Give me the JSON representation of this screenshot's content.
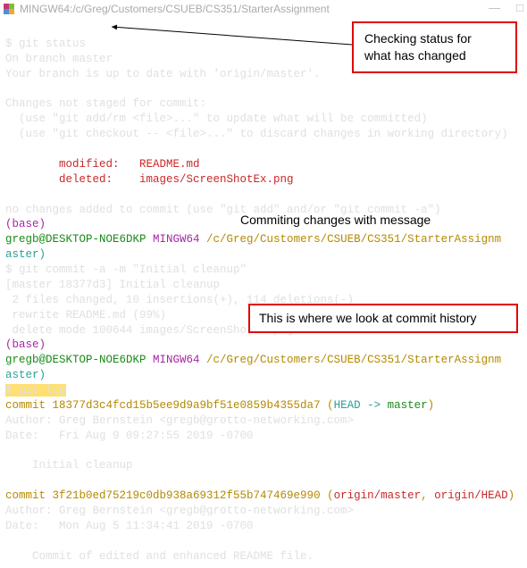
{
  "titlebar": {
    "title": "MINGW64:/c/Greg/Customers/CSUEB/CS351/StarterAssignment",
    "min": "—",
    "max": "□"
  },
  "term": {
    "l1": "$ git status",
    "l2": "On branch master",
    "l3": "Your branch is up to date with 'origin/master'.",
    "l4": "",
    "l5": "Changes not staged for commit:",
    "l6": "  (use \"git add/rm <file>...\" to update what will be committed)",
    "l7": "  (use \"git checkout -- <file>...\" to discard changes in working directory)",
    "l8": "",
    "l9": "        modified:   README.md",
    "l10": "        deleted:    images/ScreenShotEx.png",
    "l11": "",
    "l12": "no changes added to commit (use \"git add\" and/or \"git commit -a\")",
    "base": "(base)",
    "prompt_user": "gregb@DESKTOP-NOE6DKP",
    "prompt_mingw": " MINGW64 ",
    "prompt_path": "/c/Greg/Customers/CSUEB/CS351/StarterAssignm",
    "prompt_branch": "aster)",
    "l15": "$ git commit -a -m \"Initial cleanup\"",
    "l16": "[master 18377d3] Initial cleanup",
    "l17": " 2 files changed, 10 insertions(+), 114 deletions(-)",
    "l18": " rewrite README.md (99%)",
    "l19": " delete mode 100644 images/ScreenShotEx.png",
    "prompt_path2": "/c/Greg/Customers/CSUEB/CS351/StarterAssignm",
    "l22": "$ git log",
    "l23a": "commit ",
    "l23b": "18377d3c4fcd15b5ee9d9a9bf51e0859b4355da7",
    "l23c": " (",
    "l23d": "HEAD -> ",
    "l23e": "master",
    "l23f": ")",
    "l24": "Author: Greg Bernstein <gregb@grotto-networking.com>",
    "l25": "Date:   Fri Aug 9 09:27:55 2019 -0700",
    "l26": "",
    "l27": "    Initial cleanup",
    "l28": "",
    "l29a": "commit ",
    "l29b": "3f21b0ed75219c0db938a69312f55b747469e990",
    "l29c": " (",
    "l29d": "origin/master",
    "l29e": ", ",
    "l29f": "origin/HEAD",
    "l29g": ")",
    "l30": "Author: Greg Bernstein <gregb@grotto-networking.com>",
    "l31": "Date:   Mon Aug 5 11:34:41 2019 -0700",
    "l32": "",
    "l33": "    Commit of edited and enhanced README file."
  },
  "annotations": {
    "a1l1": "Checking status for",
    "a1l2": "what has changed",
    "a2": "Commiting changes with message",
    "a3": "This is where we look at commit history"
  }
}
